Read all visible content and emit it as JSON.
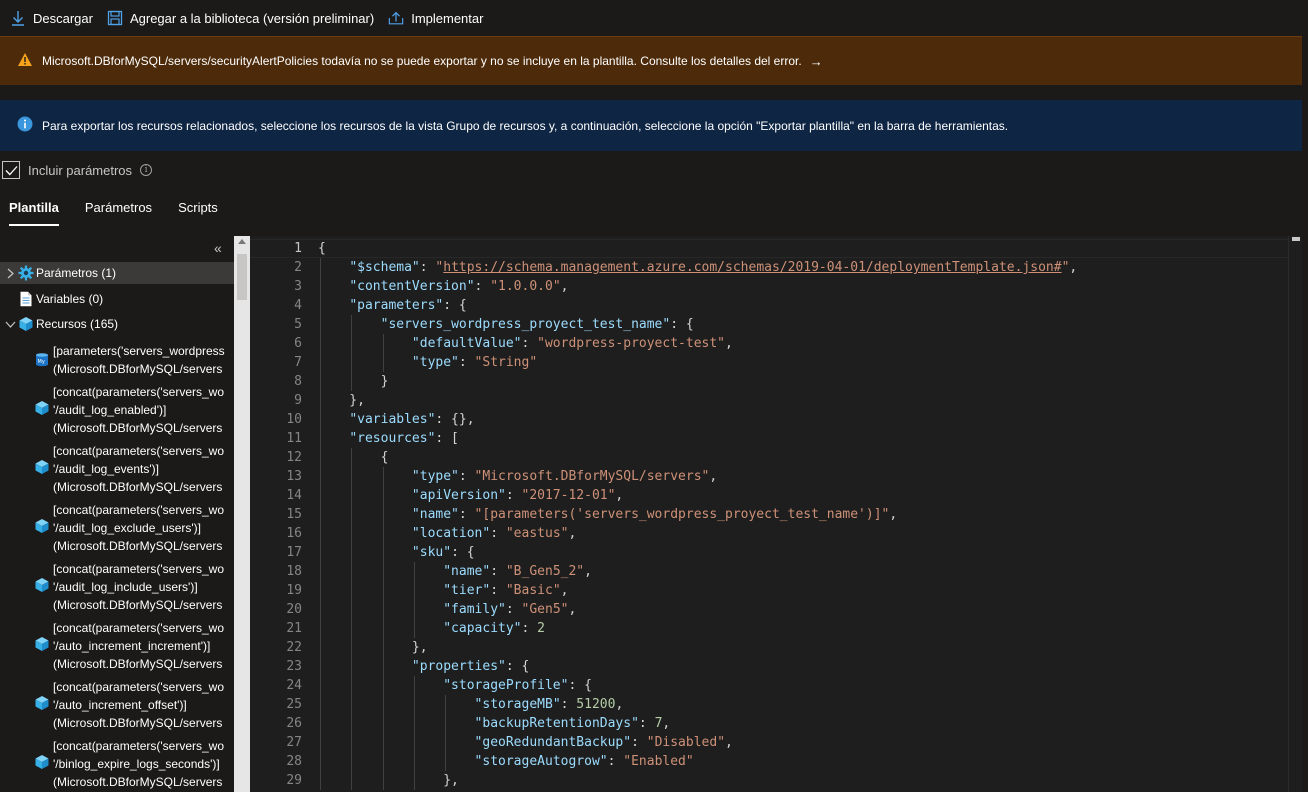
{
  "toolbar": {
    "download_label": "Descargar",
    "add_library_label": "Agregar a la biblioteca (versión preliminar)",
    "deploy_label": "Implementar"
  },
  "warning": {
    "message": "Microsoft.DBforMySQL/servers/securityAlertPolicies todavía no se puede exportar y no se incluye en la plantilla. Consulte los detalles del error.",
    "arrow": "→"
  },
  "info": {
    "message": "Para exportar los recursos relacionados, seleccione los recursos de la vista Grupo de recursos y, a continuación, seleccione la opción \"Exportar plantilla\" en la barra de herramientas."
  },
  "include_params": {
    "label": "Incluir parámetros",
    "checked": true
  },
  "tabs": [
    "Plantilla",
    "Parámetros",
    "Scripts"
  ],
  "active_tab": "Plantilla",
  "tree": {
    "nodes": [
      {
        "label": "Parámetros (1)",
        "icon": "gear-icon",
        "expanded": false,
        "selected": true
      },
      {
        "label": "Variables (0)",
        "icon": "document-icon"
      },
      {
        "label": "Recursos (165)",
        "icon": "cube-icon",
        "expanded": true
      }
    ],
    "resources": [
      {
        "lines": [
          "[parameters('servers_wordpress",
          "(Microsoft.DBforMySQL/servers"
        ],
        "icon": "mysql-icon"
      },
      {
        "lines": [
          "[concat(parameters('servers_wo",
          "'/audit_log_enabled')]",
          "(Microsoft.DBforMySQL/servers"
        ],
        "icon": "cube-icon"
      },
      {
        "lines": [
          "[concat(parameters('servers_wo",
          "'/audit_log_events')]",
          "(Microsoft.DBforMySQL/servers"
        ],
        "icon": "cube-icon"
      },
      {
        "lines": [
          "[concat(parameters('servers_wo",
          "'/audit_log_exclude_users')]",
          "(Microsoft.DBforMySQL/servers"
        ],
        "icon": "cube-icon"
      },
      {
        "lines": [
          "[concat(parameters('servers_wo",
          "'/audit_log_include_users')]",
          "(Microsoft.DBforMySQL/servers"
        ],
        "icon": "cube-icon"
      },
      {
        "lines": [
          "[concat(parameters('servers_wo",
          "'/auto_increment_increment')]",
          "(Microsoft.DBforMySQL/servers"
        ],
        "icon": "cube-icon"
      },
      {
        "lines": [
          "[concat(parameters('servers_wo",
          "'/auto_increment_offset')]",
          "(Microsoft.DBforMySQL/servers"
        ],
        "icon": "cube-icon"
      },
      {
        "lines": [
          "[concat(parameters('servers_wo",
          "'/binlog_expire_logs_seconds')]",
          "(Microsoft.DBforMySQL/servers"
        ],
        "icon": "cube-icon"
      }
    ]
  },
  "editor": {
    "line_numbers": [
      "1",
      "2",
      "3",
      "4",
      "5",
      "6",
      "7",
      "8",
      "9",
      "10",
      "11",
      "12",
      "13",
      "14",
      "15",
      "16",
      "17",
      "18",
      "19",
      "20",
      "21",
      "22",
      "23",
      "24",
      "25",
      "26",
      "27",
      "28",
      "29"
    ],
    "lines": [
      [
        [
          "p",
          "{"
        ]
      ],
      [
        [
          "p",
          "    "
        ],
        [
          "k",
          "\"$schema\""
        ],
        [
          "p",
          ": "
        ],
        [
          "s",
          "\""
        ],
        [
          "u",
          "https://schema.management.azure.com/schemas/2019-04-01/deploymentTemplate.json#"
        ],
        [
          "s",
          "\""
        ],
        [
          "p",
          ","
        ]
      ],
      [
        [
          "p",
          "    "
        ],
        [
          "k",
          "\"contentVersion\""
        ],
        [
          "p",
          ": "
        ],
        [
          "s",
          "\"1.0.0.0\""
        ],
        [
          "p",
          ","
        ]
      ],
      [
        [
          "p",
          "    "
        ],
        [
          "k",
          "\"parameters\""
        ],
        [
          "p",
          ": {"
        ]
      ],
      [
        [
          "p",
          "        "
        ],
        [
          "k",
          "\"servers_wordpress_proyect_test_name\""
        ],
        [
          "p",
          ": {"
        ]
      ],
      [
        [
          "p",
          "            "
        ],
        [
          "k",
          "\"defaultValue\""
        ],
        [
          "p",
          ": "
        ],
        [
          "s",
          "\"wordpress-proyect-test\""
        ],
        [
          "p",
          ","
        ]
      ],
      [
        [
          "p",
          "            "
        ],
        [
          "k",
          "\"type\""
        ],
        [
          "p",
          ": "
        ],
        [
          "s",
          "\"String\""
        ]
      ],
      [
        [
          "p",
          "        }"
        ]
      ],
      [
        [
          "p",
          "    },"
        ]
      ],
      [
        [
          "p",
          "    "
        ],
        [
          "k",
          "\"variables\""
        ],
        [
          "p",
          ": {},"
        ]
      ],
      [
        [
          "p",
          "    "
        ],
        [
          "k",
          "\"resources\""
        ],
        [
          "p",
          ": ["
        ]
      ],
      [
        [
          "p",
          "        {"
        ]
      ],
      [
        [
          "p",
          "            "
        ],
        [
          "k",
          "\"type\""
        ],
        [
          "p",
          ": "
        ],
        [
          "s",
          "\"Microsoft.DBforMySQL/servers\""
        ],
        [
          "p",
          ","
        ]
      ],
      [
        [
          "p",
          "            "
        ],
        [
          "k",
          "\"apiVersion\""
        ],
        [
          "p",
          ": "
        ],
        [
          "s",
          "\"2017-12-01\""
        ],
        [
          "p",
          ","
        ]
      ],
      [
        [
          "p",
          "            "
        ],
        [
          "k",
          "\"name\""
        ],
        [
          "p",
          ": "
        ],
        [
          "s",
          "\"[parameters('servers_wordpress_proyect_test_name')]\""
        ],
        [
          "p",
          ","
        ]
      ],
      [
        [
          "p",
          "            "
        ],
        [
          "k",
          "\"location\""
        ],
        [
          "p",
          ": "
        ],
        [
          "s",
          "\"eastus\""
        ],
        [
          "p",
          ","
        ]
      ],
      [
        [
          "p",
          "            "
        ],
        [
          "k",
          "\"sku\""
        ],
        [
          "p",
          ": {"
        ]
      ],
      [
        [
          "p",
          "                "
        ],
        [
          "k",
          "\"name\""
        ],
        [
          "p",
          ": "
        ],
        [
          "s",
          "\"B_Gen5_2\""
        ],
        [
          "p",
          ","
        ]
      ],
      [
        [
          "p",
          "                "
        ],
        [
          "k",
          "\"tier\""
        ],
        [
          "p",
          ": "
        ],
        [
          "s",
          "\"Basic\""
        ],
        [
          "p",
          ","
        ]
      ],
      [
        [
          "p",
          "                "
        ],
        [
          "k",
          "\"family\""
        ],
        [
          "p",
          ": "
        ],
        [
          "s",
          "\"Gen5\""
        ],
        [
          "p",
          ","
        ]
      ],
      [
        [
          "p",
          "                "
        ],
        [
          "k",
          "\"capacity\""
        ],
        [
          "p",
          ": "
        ],
        [
          "n",
          "2"
        ]
      ],
      [
        [
          "p",
          "            },"
        ]
      ],
      [
        [
          "p",
          "            "
        ],
        [
          "k",
          "\"properties\""
        ],
        [
          "p",
          ": {"
        ]
      ],
      [
        [
          "p",
          "                "
        ],
        [
          "k",
          "\"storageProfile\""
        ],
        [
          "p",
          ": {"
        ]
      ],
      [
        [
          "p",
          "                    "
        ],
        [
          "k",
          "\"storageMB\""
        ],
        [
          "p",
          ": "
        ],
        [
          "n",
          "51200"
        ],
        [
          "p",
          ","
        ]
      ],
      [
        [
          "p",
          "                    "
        ],
        [
          "k",
          "\"backupRetentionDays\""
        ],
        [
          "p",
          ": "
        ],
        [
          "n",
          "7"
        ],
        [
          "p",
          ","
        ]
      ],
      [
        [
          "p",
          "                    "
        ],
        [
          "k",
          "\"geoRedundantBackup\""
        ],
        [
          "p",
          ": "
        ],
        [
          "s",
          "\"Disabled\""
        ],
        [
          "p",
          ","
        ]
      ],
      [
        [
          "p",
          "                    "
        ],
        [
          "k",
          "\"storageAutogrow\""
        ],
        [
          "p",
          ": "
        ],
        [
          "s",
          "\"Enabled\""
        ]
      ],
      [
        [
          "p",
          "                },"
        ]
      ]
    ]
  }
}
